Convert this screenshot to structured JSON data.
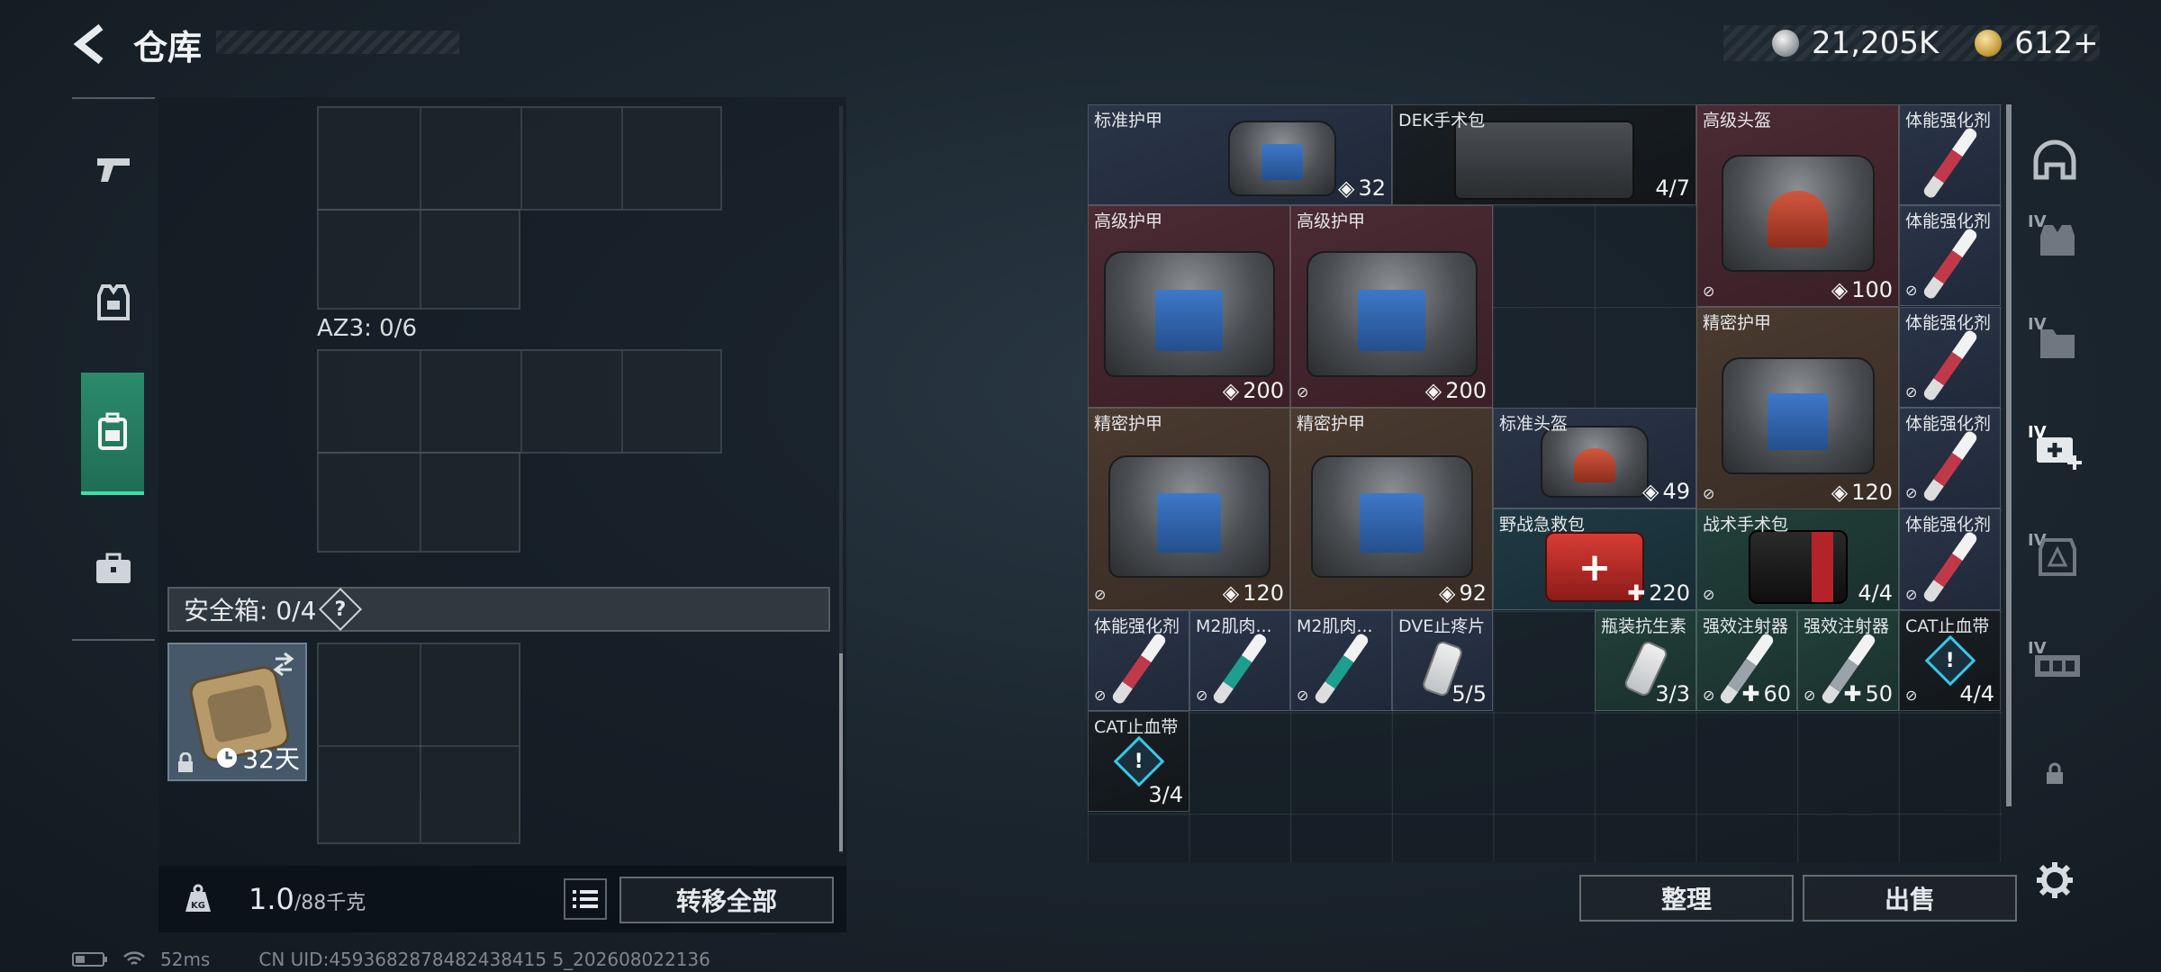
{
  "header": {
    "title": "仓库",
    "currency_silver": "21,205K",
    "currency_gold": "612+"
  },
  "left_nav": [
    "weapon-icon",
    "armor-icon",
    "backpack-icon",
    "briefcase-icon"
  ],
  "left_panel": {
    "az3_label": "AZ3: 0/6",
    "safe_label": "安全箱: 0/4",
    "safe_help": "?",
    "safe_days": "32天",
    "weight_value": "1.0",
    "weight_max": "/88千克",
    "weight_icon_text": "KG",
    "transfer_all": "转移全部"
  },
  "stash": {
    "items": [
      {
        "name": "标准护甲",
        "val": "32"
      },
      {
        "name": "DEK手术包",
        "val": "4/7"
      },
      {
        "name": "高级头盔",
        "val": "100"
      },
      {
        "name": "体能强化剂",
        "val": ""
      },
      {
        "name": "高级护甲",
        "val": "200"
      },
      {
        "name": "高级护甲",
        "val": "200"
      },
      {
        "name": "体能强化剂",
        "val": ""
      },
      {
        "name": "精密护甲",
        "val": "120"
      },
      {
        "name": "体能强化剂",
        "val": ""
      },
      {
        "name": "精密护甲",
        "val": "120"
      },
      {
        "name": "精密护甲",
        "val": "92"
      },
      {
        "name": "标准头盔",
        "val": "49"
      },
      {
        "name": "体能强化剂",
        "val": ""
      },
      {
        "name": "野战急救包",
        "val": "220"
      },
      {
        "name": "战术手术包",
        "val": "4/4"
      },
      {
        "name": "体能强化剂",
        "val": ""
      },
      {
        "name": "体能强化剂",
        "val": ""
      },
      {
        "name": "M2肌肉...",
        "val": ""
      },
      {
        "name": "M2肌肉...",
        "val": ""
      },
      {
        "name": "DVE止疼片",
        "val": "5/5"
      },
      {
        "name": "瓶装抗生素",
        "val": "3/3"
      },
      {
        "name": "强效注射器",
        "val": "60"
      },
      {
        "name": "强效注射器",
        "val": "50"
      },
      {
        "name": "CAT止血带",
        "val": "4/4"
      },
      {
        "name": "CAT止血带",
        "val": "3/4"
      }
    ]
  },
  "right_nav": [
    {
      "icon": "helmet-icon",
      "tier": ""
    },
    {
      "icon": "vest-icon",
      "tier": "IV"
    },
    {
      "icon": "folder-icon",
      "tier": "IV"
    },
    {
      "icon": "medkit-add-icon",
      "tier": "IV"
    },
    {
      "icon": "armor-plate-icon",
      "tier": "IV"
    },
    {
      "icon": "rig-icon",
      "tier": "IV"
    },
    {
      "icon": "lock-icon",
      "tier": ""
    }
  ],
  "actions": {
    "sort": "整理",
    "sell": "出售"
  },
  "footer": {
    "ping": "52ms",
    "uid": "CN UID:4593682878482438415 5_202608022136"
  }
}
